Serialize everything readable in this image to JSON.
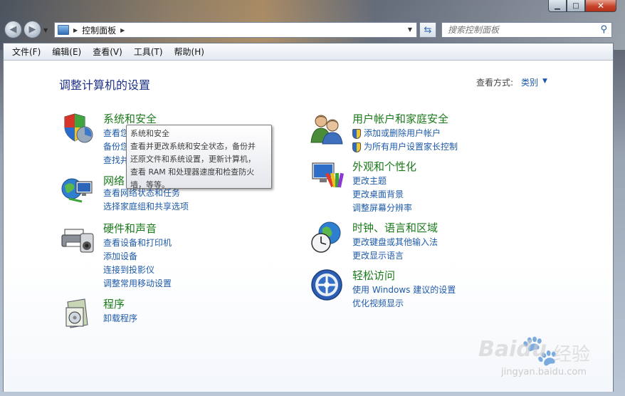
{
  "window": {
    "caption_buttons": {
      "minimize": "▁",
      "maximize": "□",
      "close": "✕"
    }
  },
  "nav": {
    "back_icon": "back-arrow-icon",
    "forward_icon": "forward-arrow-icon",
    "breadcrumb": "控制面板",
    "search_placeholder": "搜索控制面板"
  },
  "menu": [
    "文件(F)",
    "编辑(E)",
    "查看(V)",
    "工具(T)",
    "帮助(H)"
  ],
  "page": {
    "title": "调整计算机的设置",
    "view_by_label": "查看方式:",
    "view_by_value": "类别"
  },
  "categories": {
    "system": {
      "name": "系统和安全",
      "links": [
        "查看您",
        "备份您",
        "查找并"
      ]
    },
    "network": {
      "name": "网络",
      "links": [
        "查看网络状态和任务",
        "选择家庭组和共享选项"
      ]
    },
    "hardware": {
      "name": "硬件和声音",
      "links": [
        "查看设备和打印机",
        "添加设备",
        "连接到投影仪",
        "调整常用移动设置"
      ]
    },
    "programs": {
      "name": "程序",
      "links": [
        "卸载程序"
      ]
    },
    "users": {
      "name": "用户帐户和家庭安全",
      "links": [
        "添加或删除用户帐户",
        "为所有用户设置家长控制"
      ]
    },
    "appearance": {
      "name": "外观和个性化",
      "links": [
        "更改主题",
        "更改桌面背景",
        "调整屏幕分辨率"
      ]
    },
    "clock": {
      "name": "时钟、语言和区域",
      "links": [
        "更改键盘或其他输入法",
        "更改显示语言"
      ]
    },
    "ease": {
      "name": "轻松访问",
      "links": [
        "使用 Windows 建议的设置",
        "优化视频显示"
      ]
    }
  },
  "tooltip": {
    "title": "系统和安全",
    "lines": [
      "查看并更改系统和安全状态，备份并",
      "还原文件和系统设置，更新计算机，",
      "查看 RAM 和处理器速度和检查防火",
      "墙，等等。"
    ]
  },
  "watermark": {
    "brand": "Baidu",
    "product": "经验",
    "url": "jingyan.baidu.com"
  }
}
